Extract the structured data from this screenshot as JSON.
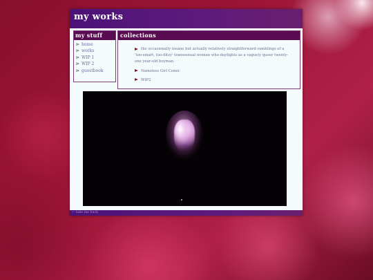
{
  "site": {
    "title": "my works"
  },
  "sidebar": {
    "heading": "my stuff",
    "items": [
      {
        "arrow": "⊳",
        "label": "home"
      },
      {
        "arrow": "⊳",
        "label": "works"
      },
      {
        "arrow": "⊳",
        "label": "WIP 1"
      },
      {
        "arrow": "⊳",
        "label": "WIP 2"
      },
      {
        "arrow": "⊳",
        "label": "guestbook"
      }
    ]
  },
  "collections": {
    "heading": "collections",
    "items": [
      {
        "label": "the occasionally insane but actually relatively straightforward ramblings of a 'too-smart, too-ditzy' transsexual woman who daylights as a vaguely queer twenty-one year-old boyman."
      },
      {
        "label": "Nameless Girl Comic"
      },
      {
        "label": "WIP2"
      }
    ]
  },
  "footer": {
    "link_text": "←  take me back"
  },
  "colors": {
    "page_bg": "#f3fbfd",
    "header_bg": "#4b1278",
    "panel_head_bg": "#5a0c52",
    "link_color": "#6a6a9a",
    "arrow_color": "#8a0d25",
    "backdrop": "#9c1538"
  }
}
